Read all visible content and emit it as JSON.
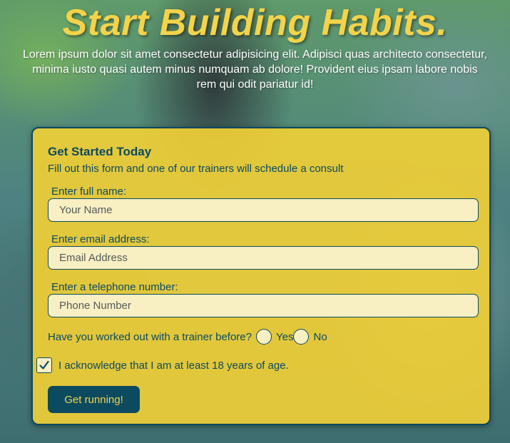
{
  "hero": {
    "title": "Start Building Habits.",
    "text": "Lorem ipsum dolor sit amet consectetur adipisicing elit. Adipisci quas architecto consectetur, minima iusto quasi autem minus numquam ab dolore! Provident eius ipsam labore nobis rem qui odit pariatur id!"
  },
  "form": {
    "title": "Get Started Today",
    "subtitle": "Fill out this form and one of our trainers will schedule a consult",
    "fields": [
      {
        "label": "Enter full name:",
        "placeholder": "Your Name",
        "value": ""
      },
      {
        "label": "Enter email address:",
        "placeholder": "Email Address",
        "value": ""
      },
      {
        "label": "Enter a telephone number:",
        "placeholder": "Phone Number",
        "value": ""
      }
    ],
    "trainer_question": {
      "label": "Have you worked out with a trainer before?",
      "options": [
        "Yes",
        "No"
      ],
      "selected": null
    },
    "age_ack": {
      "label": "I acknowledge that I am at least 18 years of age.",
      "checked": true
    },
    "submit_label": "Get running!"
  },
  "colors": {
    "accent_yellow": "#f4d34a",
    "card_yellow": "#eecd37",
    "dark_teal": "#0c4a60",
    "input_bg": "#f8efc3"
  }
}
